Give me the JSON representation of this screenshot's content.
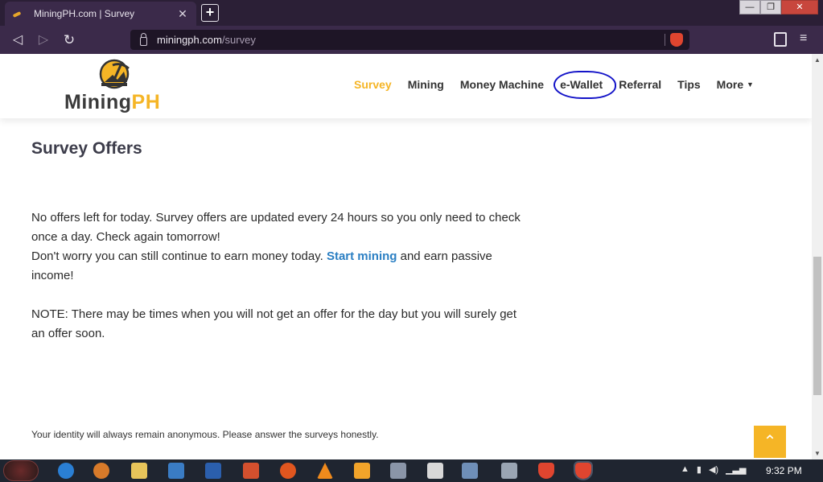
{
  "browser": {
    "tab_title": "MiningPH.com | Survey",
    "tab_close": "✕",
    "new_tab": "+",
    "url_host": "miningph.com",
    "url_path": "/survey",
    "back_glyph": "◁",
    "forward_glyph": "▷",
    "reload_glyph": "↻",
    "menu_glyph": "≡",
    "window_min": "—",
    "window_max": "❐",
    "window_close": "✕"
  },
  "site": {
    "logo_text_mining": "Mining",
    "logo_text_ph": "PH",
    "nav": [
      {
        "label": "Survey"
      },
      {
        "label": "Mining"
      },
      {
        "label": "Money Machine"
      },
      {
        "label": "e-Wallet"
      },
      {
        "label": "Referral"
      },
      {
        "label": "Tips"
      },
      {
        "label": "More"
      }
    ],
    "more_caret": "▼",
    "accent_color": "#f5b526",
    "link_color": "#2b7fc3"
  },
  "content": {
    "title": "Survey Offers",
    "p1": "No offers left for today. Survey offers are updated every 24 hours so you only need to check once a day. Check again tomorrow!",
    "p2_before": "Don't worry you can still continue to earn money today. ",
    "p2_link": "Start mining",
    "p2_after": " and earn passive income!",
    "p3": "NOTE: There may be times when you will not get an offer for the day but you will surely get an offer soon.",
    "footnote": "Your identity will always remain anonymous. Please answer the surveys honestly.",
    "to_top_glyph": "⌃"
  },
  "taskbar": {
    "clock": "9:32 PM",
    "tray_caret": "▲"
  }
}
